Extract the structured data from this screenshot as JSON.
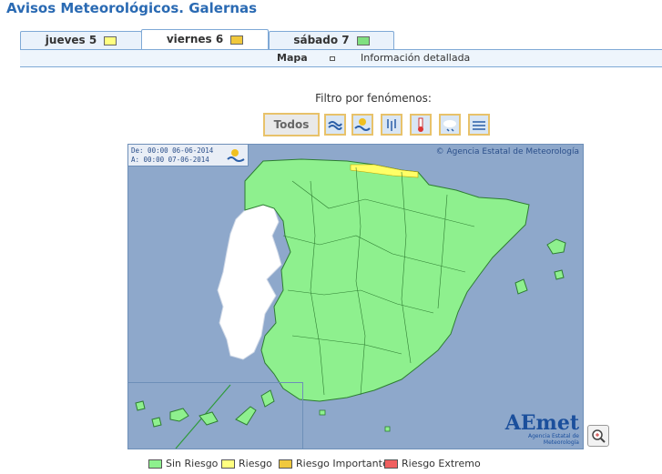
{
  "page": {
    "title": "Avisos Meteorológicos. Galernas"
  },
  "tabs": [
    {
      "label": "jueves 5",
      "color": "#ffff80"
    },
    {
      "label": "viernes 6",
      "color": "#f0c83c"
    },
    {
      "label": "sábado 7",
      "color": "#80e080"
    }
  ],
  "subnav": {
    "mapa": "Mapa",
    "info": "Información detallada"
  },
  "filter": {
    "label": "Filtro por fenómenos:",
    "todos": "Todos",
    "icons": [
      "viento-icon",
      "galerna-icon",
      "lluvia-icon",
      "temperatura-icon",
      "nieve-icon",
      "niebla-icon"
    ]
  },
  "map": {
    "date_from": "De: 00:00 06-06-2014",
    "date_to": "A:  00:00 07-06-2014",
    "copyright": "Agencia Estatal de Meteorología",
    "logo_text": "AEmet",
    "logo_sub": "Agencia Estatal de Meteorología",
    "colors": {
      "land": "#8ef08e",
      "sea": "#8ea8cb",
      "warning": "#ffff66",
      "portugal": "#ffffff"
    }
  },
  "legend": [
    {
      "label": "Sin Riesgo",
      "color": "#8ef08e"
    },
    {
      "label": "Riesgo",
      "color": "#ffff80"
    },
    {
      "label": "Riesgo Importante",
      "color": "#f0c83c"
    },
    {
      "label": "Riesgo Extremo",
      "color": "#f06060"
    }
  ]
}
